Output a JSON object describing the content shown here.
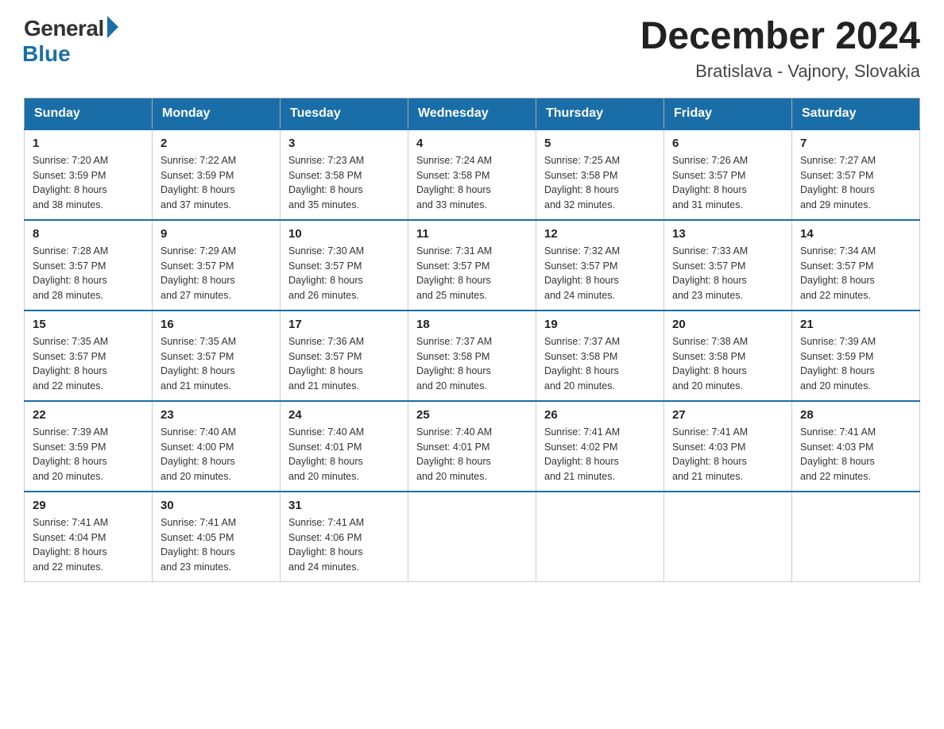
{
  "logo": {
    "general": "General",
    "blue": "Blue"
  },
  "title": "December 2024",
  "subtitle": "Bratislava - Vajnory, Slovakia",
  "days_of_week": [
    "Sunday",
    "Monday",
    "Tuesday",
    "Wednesday",
    "Thursday",
    "Friday",
    "Saturday"
  ],
  "weeks": [
    [
      {
        "day": "1",
        "sunrise": "7:20 AM",
        "sunset": "3:59 PM",
        "daylight": "8 hours and 38 minutes."
      },
      {
        "day": "2",
        "sunrise": "7:22 AM",
        "sunset": "3:59 PM",
        "daylight": "8 hours and 37 minutes."
      },
      {
        "day": "3",
        "sunrise": "7:23 AM",
        "sunset": "3:58 PM",
        "daylight": "8 hours and 35 minutes."
      },
      {
        "day": "4",
        "sunrise": "7:24 AM",
        "sunset": "3:58 PM",
        "daylight": "8 hours and 33 minutes."
      },
      {
        "day": "5",
        "sunrise": "7:25 AM",
        "sunset": "3:58 PM",
        "daylight": "8 hours and 32 minutes."
      },
      {
        "day": "6",
        "sunrise": "7:26 AM",
        "sunset": "3:57 PM",
        "daylight": "8 hours and 31 minutes."
      },
      {
        "day": "7",
        "sunrise": "7:27 AM",
        "sunset": "3:57 PM",
        "daylight": "8 hours and 29 minutes."
      }
    ],
    [
      {
        "day": "8",
        "sunrise": "7:28 AM",
        "sunset": "3:57 PM",
        "daylight": "8 hours and 28 minutes."
      },
      {
        "day": "9",
        "sunrise": "7:29 AM",
        "sunset": "3:57 PM",
        "daylight": "8 hours and 27 minutes."
      },
      {
        "day": "10",
        "sunrise": "7:30 AM",
        "sunset": "3:57 PM",
        "daylight": "8 hours and 26 minutes."
      },
      {
        "day": "11",
        "sunrise": "7:31 AM",
        "sunset": "3:57 PM",
        "daylight": "8 hours and 25 minutes."
      },
      {
        "day": "12",
        "sunrise": "7:32 AM",
        "sunset": "3:57 PM",
        "daylight": "8 hours and 24 minutes."
      },
      {
        "day": "13",
        "sunrise": "7:33 AM",
        "sunset": "3:57 PM",
        "daylight": "8 hours and 23 minutes."
      },
      {
        "day": "14",
        "sunrise": "7:34 AM",
        "sunset": "3:57 PM",
        "daylight": "8 hours and 22 minutes."
      }
    ],
    [
      {
        "day": "15",
        "sunrise": "7:35 AM",
        "sunset": "3:57 PM",
        "daylight": "8 hours and 22 minutes."
      },
      {
        "day": "16",
        "sunrise": "7:35 AM",
        "sunset": "3:57 PM",
        "daylight": "8 hours and 21 minutes."
      },
      {
        "day": "17",
        "sunrise": "7:36 AM",
        "sunset": "3:57 PM",
        "daylight": "8 hours and 21 minutes."
      },
      {
        "day": "18",
        "sunrise": "7:37 AM",
        "sunset": "3:58 PM",
        "daylight": "8 hours and 20 minutes."
      },
      {
        "day": "19",
        "sunrise": "7:37 AM",
        "sunset": "3:58 PM",
        "daylight": "8 hours and 20 minutes."
      },
      {
        "day": "20",
        "sunrise": "7:38 AM",
        "sunset": "3:58 PM",
        "daylight": "8 hours and 20 minutes."
      },
      {
        "day": "21",
        "sunrise": "7:39 AM",
        "sunset": "3:59 PM",
        "daylight": "8 hours and 20 minutes."
      }
    ],
    [
      {
        "day": "22",
        "sunrise": "7:39 AM",
        "sunset": "3:59 PM",
        "daylight": "8 hours and 20 minutes."
      },
      {
        "day": "23",
        "sunrise": "7:40 AM",
        "sunset": "4:00 PM",
        "daylight": "8 hours and 20 minutes."
      },
      {
        "day": "24",
        "sunrise": "7:40 AM",
        "sunset": "4:01 PM",
        "daylight": "8 hours and 20 minutes."
      },
      {
        "day": "25",
        "sunrise": "7:40 AM",
        "sunset": "4:01 PM",
        "daylight": "8 hours and 20 minutes."
      },
      {
        "day": "26",
        "sunrise": "7:41 AM",
        "sunset": "4:02 PM",
        "daylight": "8 hours and 21 minutes."
      },
      {
        "day": "27",
        "sunrise": "7:41 AM",
        "sunset": "4:03 PM",
        "daylight": "8 hours and 21 minutes."
      },
      {
        "day": "28",
        "sunrise": "7:41 AM",
        "sunset": "4:03 PM",
        "daylight": "8 hours and 22 minutes."
      }
    ],
    [
      {
        "day": "29",
        "sunrise": "7:41 AM",
        "sunset": "4:04 PM",
        "daylight": "8 hours and 22 minutes."
      },
      {
        "day": "30",
        "sunrise": "7:41 AM",
        "sunset": "4:05 PM",
        "daylight": "8 hours and 23 minutes."
      },
      {
        "day": "31",
        "sunrise": "7:41 AM",
        "sunset": "4:06 PM",
        "daylight": "8 hours and 24 minutes."
      },
      null,
      null,
      null,
      null
    ]
  ],
  "labels": {
    "sunrise": "Sunrise:",
    "sunset": "Sunset:",
    "daylight": "Daylight:"
  }
}
